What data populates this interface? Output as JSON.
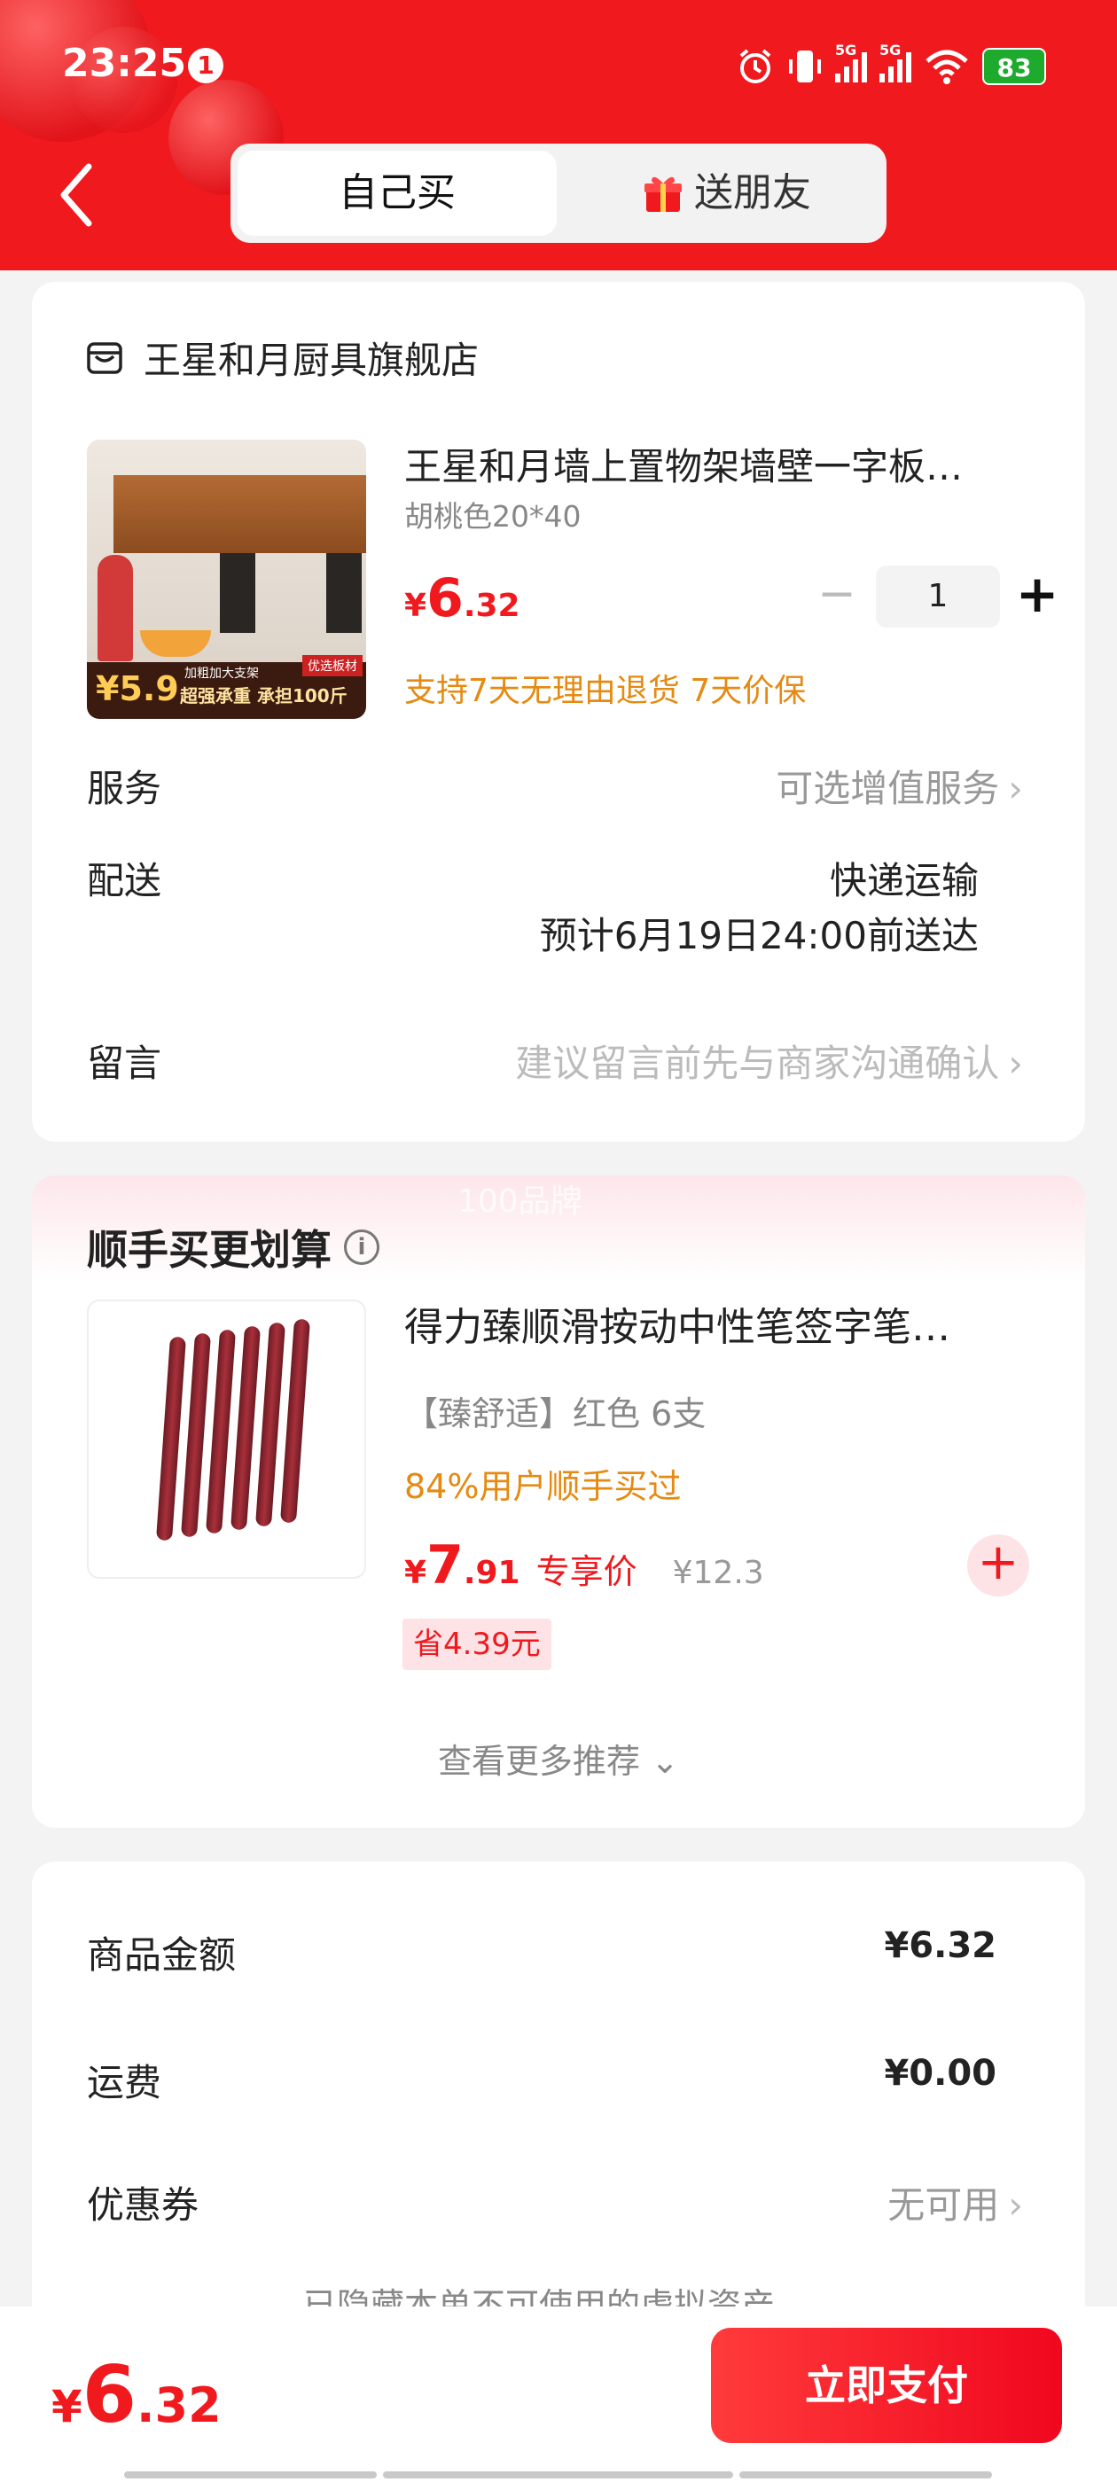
{
  "status_bar": {
    "time": "23:25",
    "notification_count": "1",
    "network": "5G",
    "battery": "83"
  },
  "header": {
    "tabs": [
      {
        "label": "自己买",
        "selected": true
      },
      {
        "label": "送朋友",
        "selected": false
      }
    ]
  },
  "order": {
    "store_name": "王星和月厨具旗舰店",
    "product": {
      "title": "王星和月墙上置物架墙壁一字板…",
      "spec": "胡桃色20*40",
      "price_yen": "¥",
      "price_int": "6",
      "price_dec": ".32",
      "quantity": "1",
      "guarantee": "支持7天无理由退货 7天价保",
      "image_text": {
        "price": "¥5.9",
        "slogan": "超强承重 承担100斤",
        "chip": "优选板材",
        "chip2": "加粗加大支架"
      }
    },
    "service_label": "服务",
    "service_value": "可选增值服务",
    "delivery_label": "配送",
    "delivery_method": "快递运输",
    "delivery_eta": "预计6月19日24:00前送达",
    "message_label": "留言",
    "message_placeholder": "建议留言前先与商家沟通确认"
  },
  "addon": {
    "watermark": "100品牌",
    "section_title": "顺手买更划算",
    "product": {
      "title": "得力臻顺滑按动中性笔签字笔…",
      "spec": "【臻舒适】红色 6支",
      "stat": "84%用户顺手买过",
      "price_yen": "¥",
      "price_int": "7",
      "price_dec": ".91",
      "exclusive_label": "专享价",
      "original_price": "¥12.3",
      "save_badge": "省4.39元"
    },
    "more_label": "查看更多推荐"
  },
  "summary": {
    "rows": [
      {
        "label": "商品金额",
        "value": "¥6.32"
      },
      {
        "label": "运费",
        "value": "¥0.00"
      },
      {
        "label": "优惠券",
        "value": "无可用"
      }
    ],
    "hidden_note": "已隐藏本单不可使用的虚拟资产"
  },
  "bottom": {
    "total_yen": "¥",
    "total_int": "6",
    "total_dec": ".32",
    "pay_label": "立即支付"
  },
  "colors": {
    "brand_red": "#f0191e",
    "accent_orange": "#e58a12"
  }
}
